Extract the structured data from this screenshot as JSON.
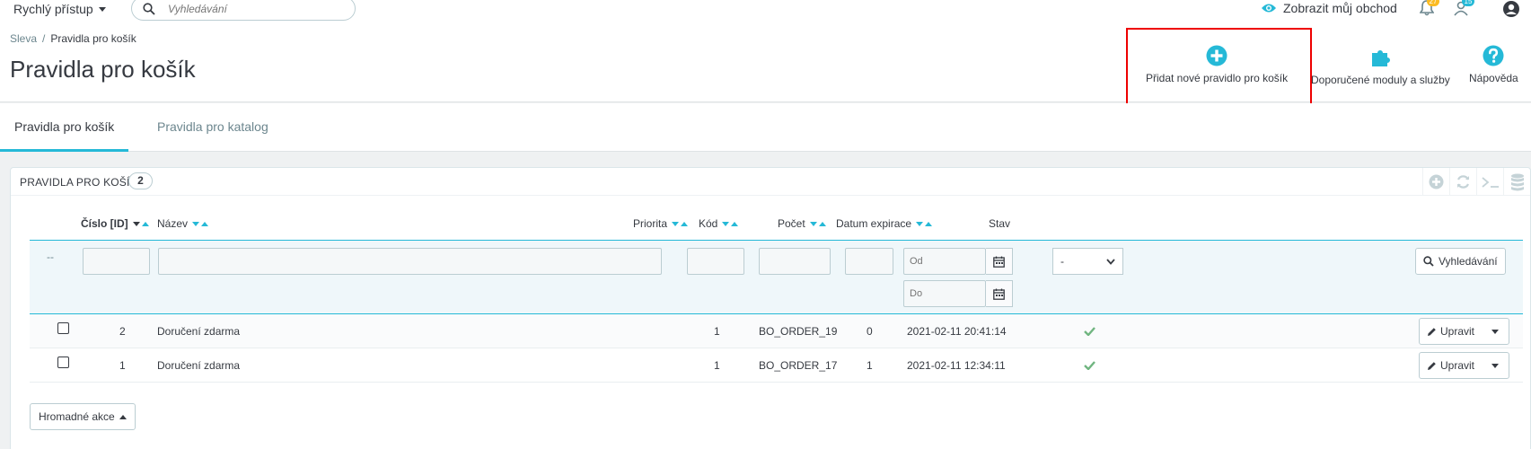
{
  "topbar": {
    "quick_access": "Rychlý přístup",
    "search_placeholder": "Vyhledávání",
    "view_shop": "Zobrazit můj obchod",
    "orders_badge": "27",
    "customers_badge": "15"
  },
  "header": {
    "breadcrumb": [
      "Sleva",
      "Pravidla pro košík"
    ],
    "title": "Pravidla pro košík",
    "toolbar": {
      "add_rule": "Přidat nové pravidlo pro košík",
      "modules": "Doporučené moduly a služby",
      "help": "Nápověda"
    }
  },
  "tabs": [
    {
      "label": "Pravidla pro košík",
      "active": true
    },
    {
      "label": "Pravidla pro katalog",
      "active": false
    }
  ],
  "panel": {
    "title": "PRAVIDLA PRO KOŠÍK",
    "count": "2",
    "columns": {
      "id": "Číslo [ID]",
      "name": "Název",
      "priority": "Priorita",
      "code": "Kód",
      "quantity": "Počet",
      "expiration": "Datum expirace",
      "status": "Stav"
    },
    "filters": {
      "row_label": "--",
      "date_from_placeholder": "Od",
      "date_to_placeholder": "Do",
      "status_selected": "-",
      "search_button": "Vyhledávání"
    },
    "rows": [
      {
        "id": "2",
        "name": "Doručení zdarma",
        "priority": "1",
        "code": "BO_ORDER_19",
        "quantity": "0",
        "expiration": "2021-02-11 20:41:14",
        "status": "enabled",
        "edit": "Upravit"
      },
      {
        "id": "1",
        "name": "Doručení zdarma",
        "priority": "1",
        "code": "BO_ORDER_17",
        "quantity": "1",
        "expiration": "2021-02-11 12:34:11",
        "status": "enabled",
        "edit": "Upravit"
      }
    ],
    "bulk_actions": "Hromadné akce"
  },
  "colors": {
    "accent": "#25b9d7",
    "success": "#70b580",
    "highlight": "#e00000"
  }
}
